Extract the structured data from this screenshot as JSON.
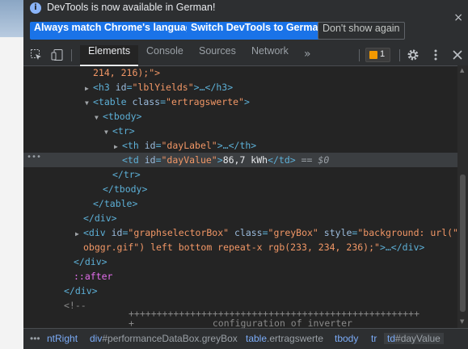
{
  "infobar": {
    "message": "DevTools is now available in German!",
    "btn_match": "Always match Chrome's language",
    "btn_switch": "Switch DevTools to German",
    "btn_dismiss": "Don't show again",
    "close": "×"
  },
  "toolbar": {
    "tabs": [
      "Elements",
      "Console",
      "Sources",
      "Network"
    ],
    "more": "»",
    "issues_count": "1"
  },
  "tree": {
    "l0": "214, 216);\">",
    "l1_tag_open": "<h3 ",
    "l1_attr": "id",
    "l1_val": "\"lblYields\"",
    "l1_rest": ">…</h3>",
    "l2_tag": "<table ",
    "l2_attr": "class",
    "l2_val": "\"ertragswerte\"",
    "l2_end": ">",
    "l3": "<tbody>",
    "l4": "<tr>",
    "l5_tag": "<th ",
    "l5_attr": "id",
    "l5_val": "\"dayLabel\"",
    "l5_rest": ">…</th>",
    "l6_tag": "<td ",
    "l6_attr": "id",
    "l6_val": "\"dayValue\"",
    "l6_gt": ">",
    "l6_text": "86,7 kWh",
    "l6_close": "</td>",
    "l6_eq": " == ",
    "l6_dollar": "$0",
    "l7": "</tr>",
    "l8": "</tbody>",
    "l9": "</table>",
    "l10": "</div>",
    "l11_tag": "<div ",
    "l11_a1": "id",
    "l11_v1": "\"graphselectorBox\"",
    "l11_a2": "class",
    "l11_v2": "\"greyBox\"",
    "l11_a3": "style",
    "l11_v3": "\"background: url(\"kac",
    "l12_v": "obggr.gif\") left bottom repeat-x rgb(233, 234, 236);\"",
    "l12_rest": ">…</div>",
    "l13": "</div>",
    "l14": "::after",
    "l15": "</div>",
    "l16": "<!--",
    "l17": "++++++++++++++++++++++++++++++++++++++++++++++++++++",
    "l18": "configuration of inverter",
    "l18_plus": "+"
  },
  "breadcrumb": {
    "c1": "ntRight",
    "c2_tag": "div",
    "c2_rest": "#performanceDataBox.greyBox",
    "c3_tag": "table",
    "c3_rest": ".ertragswerte",
    "c4": "tbody",
    "c5": "tr",
    "c6_tag": "td",
    "c6_rest": "#dayValue"
  },
  "colors": {
    "accent": "#1a73e8",
    "tag": "#5db0d7",
    "attr_value": "#f29766",
    "background": "#242424"
  }
}
